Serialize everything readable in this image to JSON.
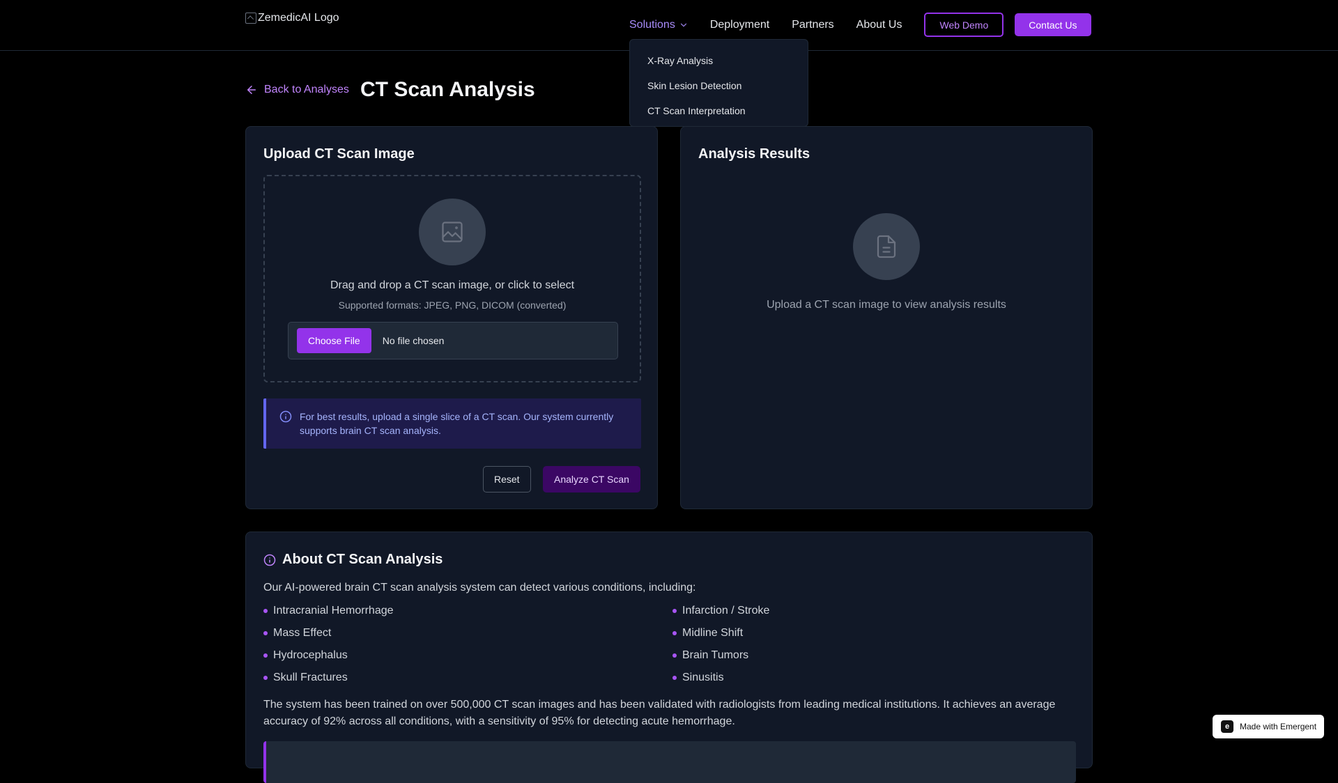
{
  "header": {
    "logo_alt": "ZemedicAI Logo",
    "nav": {
      "solutions": "Solutions",
      "deployment": "Deployment",
      "partners": "Partners",
      "about": "About Us"
    },
    "web_demo": "Web Demo",
    "contact": "Contact Us"
  },
  "dropdown": {
    "items": [
      "X-Ray Analysis",
      "Skin Lesion Detection",
      "CT Scan Interpretation"
    ]
  },
  "page": {
    "back_label": "Back to Analyses",
    "title": "CT Scan Analysis"
  },
  "upload": {
    "title": "Upload CT Scan Image",
    "drop_text": "Drag and drop a CT scan image, or click to select",
    "formats": "Supported formats: JPEG, PNG, DICOM (converted)",
    "choose_file": "Choose File",
    "no_file": "No file chosen",
    "info": "For best results, upload a single slice of a CT scan. Our system currently supports brain CT scan analysis.",
    "reset": "Reset",
    "analyze": "Analyze CT Scan"
  },
  "results": {
    "title": "Analysis Results",
    "empty_text": "Upload a CT scan image to view analysis results"
  },
  "about": {
    "title": "About CT Scan Analysis",
    "intro": "Our AI-powered brain CT scan analysis system can detect various conditions, including:",
    "conditions": [
      "Intracranial Hemorrhage",
      "Infarction / Stroke",
      "Mass Effect",
      "Midline Shift",
      "Hydrocephalus",
      "Brain Tumors",
      "Skull Fractures",
      "Sinusitis"
    ],
    "body": "The system has been trained on over 500,000 CT scan images and has been validated with radiologists from leading medical institutions. It achieves an average accuracy of 92% across all conditions, with a sensitivity of 95% for detecting acute hemorrhage."
  },
  "badge": {
    "made_with": "Made with Emergent"
  },
  "colors": {
    "accent": "#9333ea",
    "accent_light": "#c084fc",
    "card_bg": "#111827",
    "page_bg": "#000000"
  }
}
